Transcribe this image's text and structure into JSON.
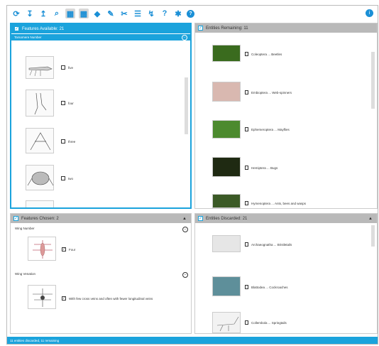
{
  "toolbar": {
    "icons": [
      "refresh-icon",
      "sort-asc-icon",
      "sort-desc-icon",
      "search-icon",
      "grid-view-icon",
      "grid-view-alt-icon",
      "diamond-icon",
      "magic-wand-icon",
      "scissors-icon",
      "list-icon",
      "filter-icon",
      "query-icon",
      "settings-icon",
      "help-icon"
    ],
    "glyphs": [
      "⟳",
      "↧",
      "↥",
      "⌕",
      "▦",
      "▩",
      "◆",
      "✎",
      "✂",
      "☰",
      "↯",
      "?",
      "✱",
      "?"
    ],
    "info": "i"
  },
  "features_available": {
    "title": "Features Available: 21",
    "section": "Tarsomere Number",
    "options": [
      "five",
      "four",
      "three",
      "two"
    ]
  },
  "entities_remaining": {
    "title": "Entities Remaining: 11",
    "items": [
      {
        "label": "Coleoptera ... Beetles",
        "color": "#3a6b1e"
      },
      {
        "label": "Embioptera ... Web-spinners",
        "color": "#d9b8b0"
      },
      {
        "label": "Ephemeroptera ... Mayflies",
        "color": "#4c8a2e"
      },
      {
        "label": "Hemiptera ... Bugs",
        "color": "#1f2a12"
      },
      {
        "label": "Hymenoptera ... Ants, bees and wasps",
        "color": "#3b5a26"
      }
    ]
  },
  "features_chosen": {
    "title": "Features Chosen: 2",
    "groups": [
      {
        "name": "Wing Number",
        "value": "Four"
      },
      {
        "name": "Wing Venation",
        "value": "With few cross veins and often with fewer longitudinal veins"
      }
    ]
  },
  "entities_discarded": {
    "title": "Entities Discarded: 21",
    "items": [
      {
        "label": "Archaeognatha ... Bristletails",
        "color": "#e6e6e6"
      },
      {
        "label": "Blattodea ... Cockroaches",
        "color": "#5e8f9a"
      },
      {
        "label": "Collembola ... Springtails",
        "color": "#f2f2f2"
      }
    ]
  },
  "status": "11 entities discarded, 11 remaining",
  "colors": {
    "accent": "#1ba3dc",
    "header_gray": "#b9b9b9"
  }
}
